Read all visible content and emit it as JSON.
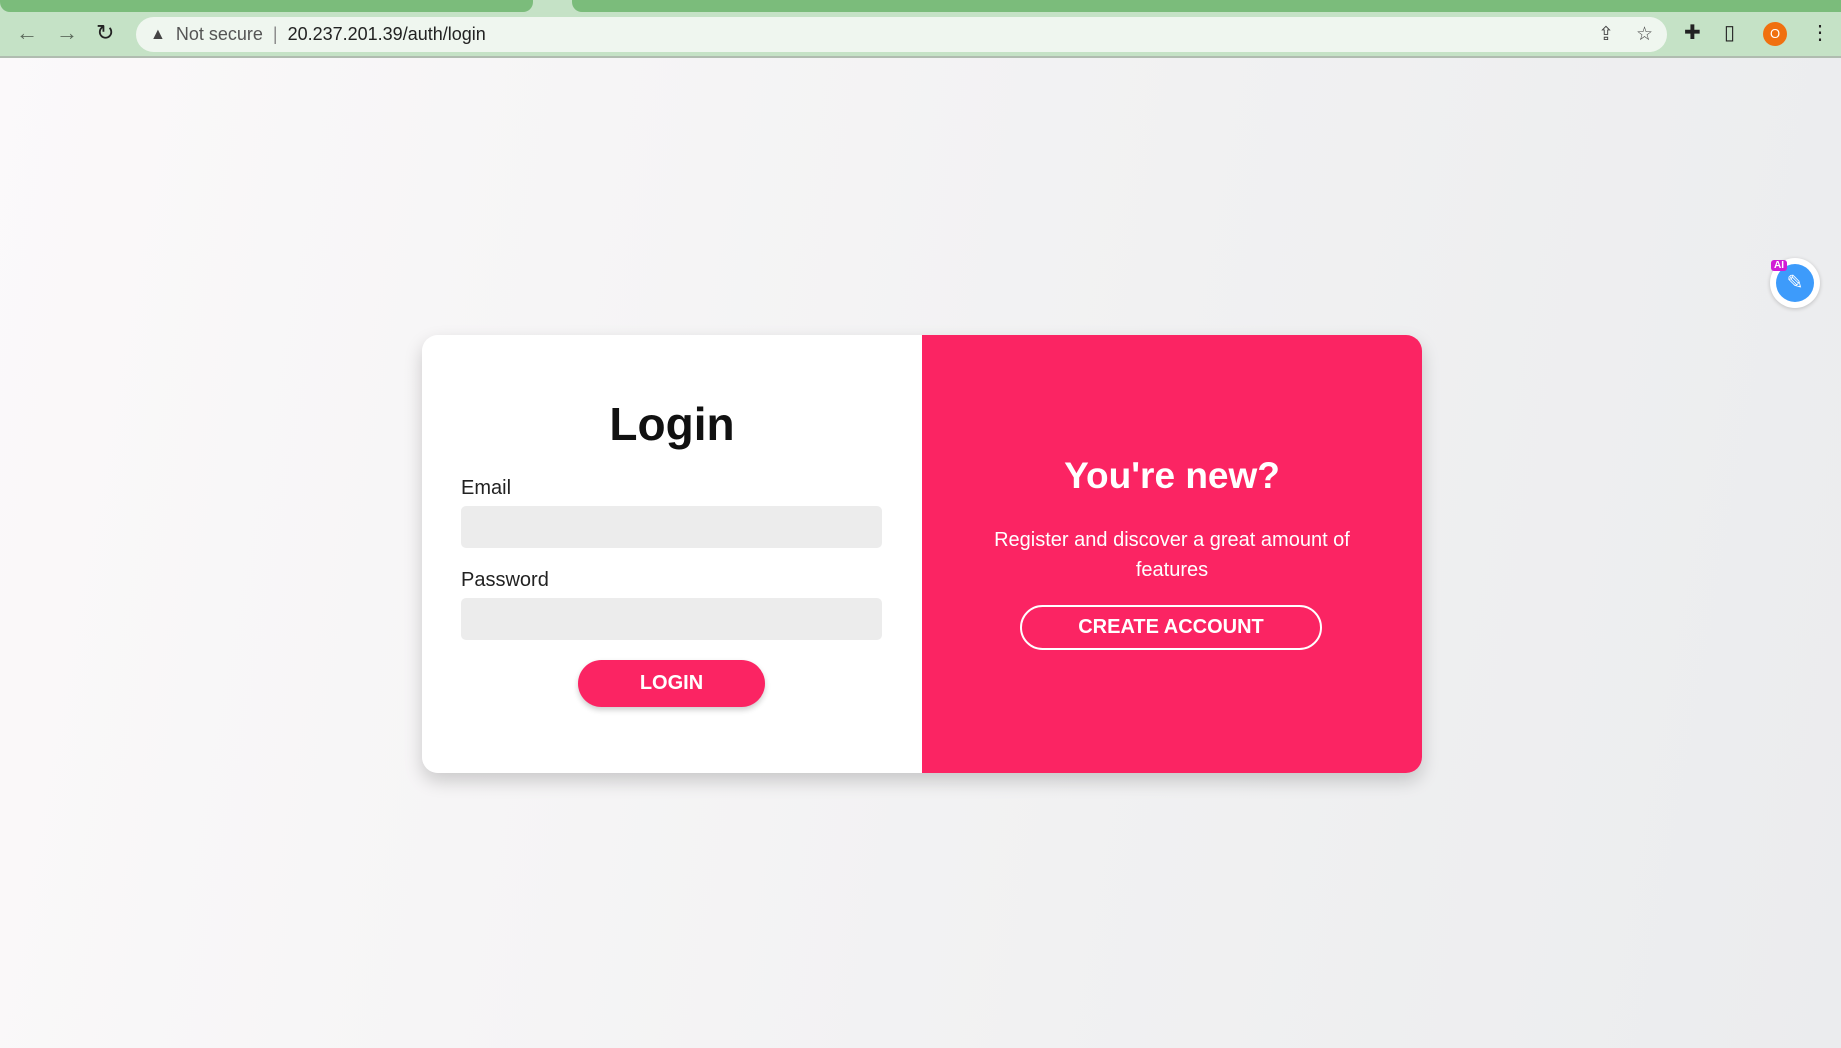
{
  "browser": {
    "security": "Not secure",
    "url": "20.237.201.39/auth/login",
    "profile_initial": "O",
    "extension_badge": "AI"
  },
  "login": {
    "title": "Login",
    "email_label": "Email",
    "email_value": "",
    "password_label": "Password",
    "password_value": "",
    "button": "LOGIN"
  },
  "register": {
    "title": "You're new?",
    "text": "Register and discover a great amount of features",
    "button": "CREATE ACCOUNT"
  },
  "colors": {
    "accent": "#fb2463"
  }
}
